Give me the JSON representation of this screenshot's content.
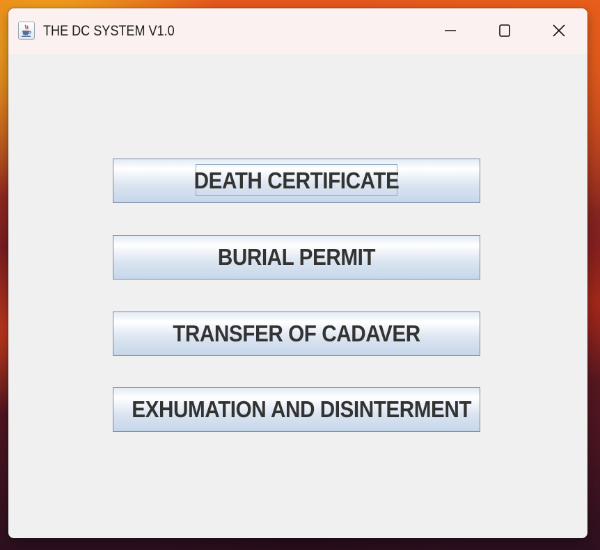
{
  "window": {
    "title": "THE DC SYSTEM V1.0",
    "icon": "java-cup-icon",
    "controls": {
      "minimize": "minimize-icon",
      "maximize": "maximize-icon",
      "close": "close-icon"
    }
  },
  "menu_buttons": [
    {
      "label": "DEATH CERTIFICATE",
      "focused": true
    },
    {
      "label": "BURIAL PERMIT"
    },
    {
      "label": "TRANSFER OF CADAVER"
    },
    {
      "label": "EXHUMATION AND DISINTERMENT"
    }
  ],
  "colors": {
    "window_bg": "#f0f0f0",
    "titlebar_bg": "#fcf1f1",
    "button_border": "#7a8aa0",
    "button_text": "#333333"
  }
}
